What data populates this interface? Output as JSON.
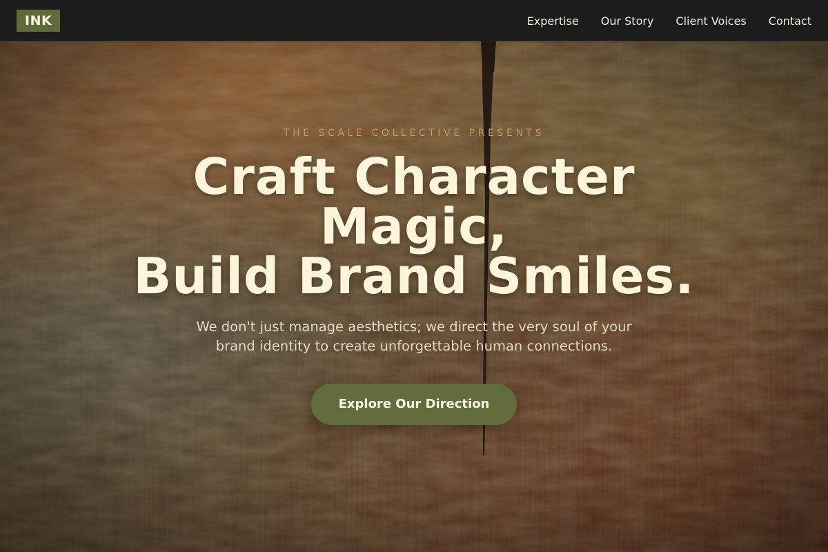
{
  "brand": {
    "logo_text": "INK"
  },
  "nav": {
    "items": [
      {
        "label": "Expertise"
      },
      {
        "label": "Our Story"
      },
      {
        "label": "Client Voices"
      },
      {
        "label": "Contact"
      }
    ]
  },
  "hero": {
    "eyebrow": "THE SCALE COLLECTIVE PRESENTS",
    "headline_lines": [
      "Craft Character",
      "Magic,",
      "Build Brand Smiles."
    ],
    "subtext": "We don't just manage aesthetics; we direct the very soul of your brand identity to create unforgettable human connections.",
    "cta_label": "Explore Our Direction"
  },
  "colors": {
    "header_bg": "#1c1c1c",
    "logo_bg": "#5f6b3a",
    "cta_bg": "#636d3c",
    "eyebrow": "#c9955a",
    "headline": "#fdf4dc"
  }
}
